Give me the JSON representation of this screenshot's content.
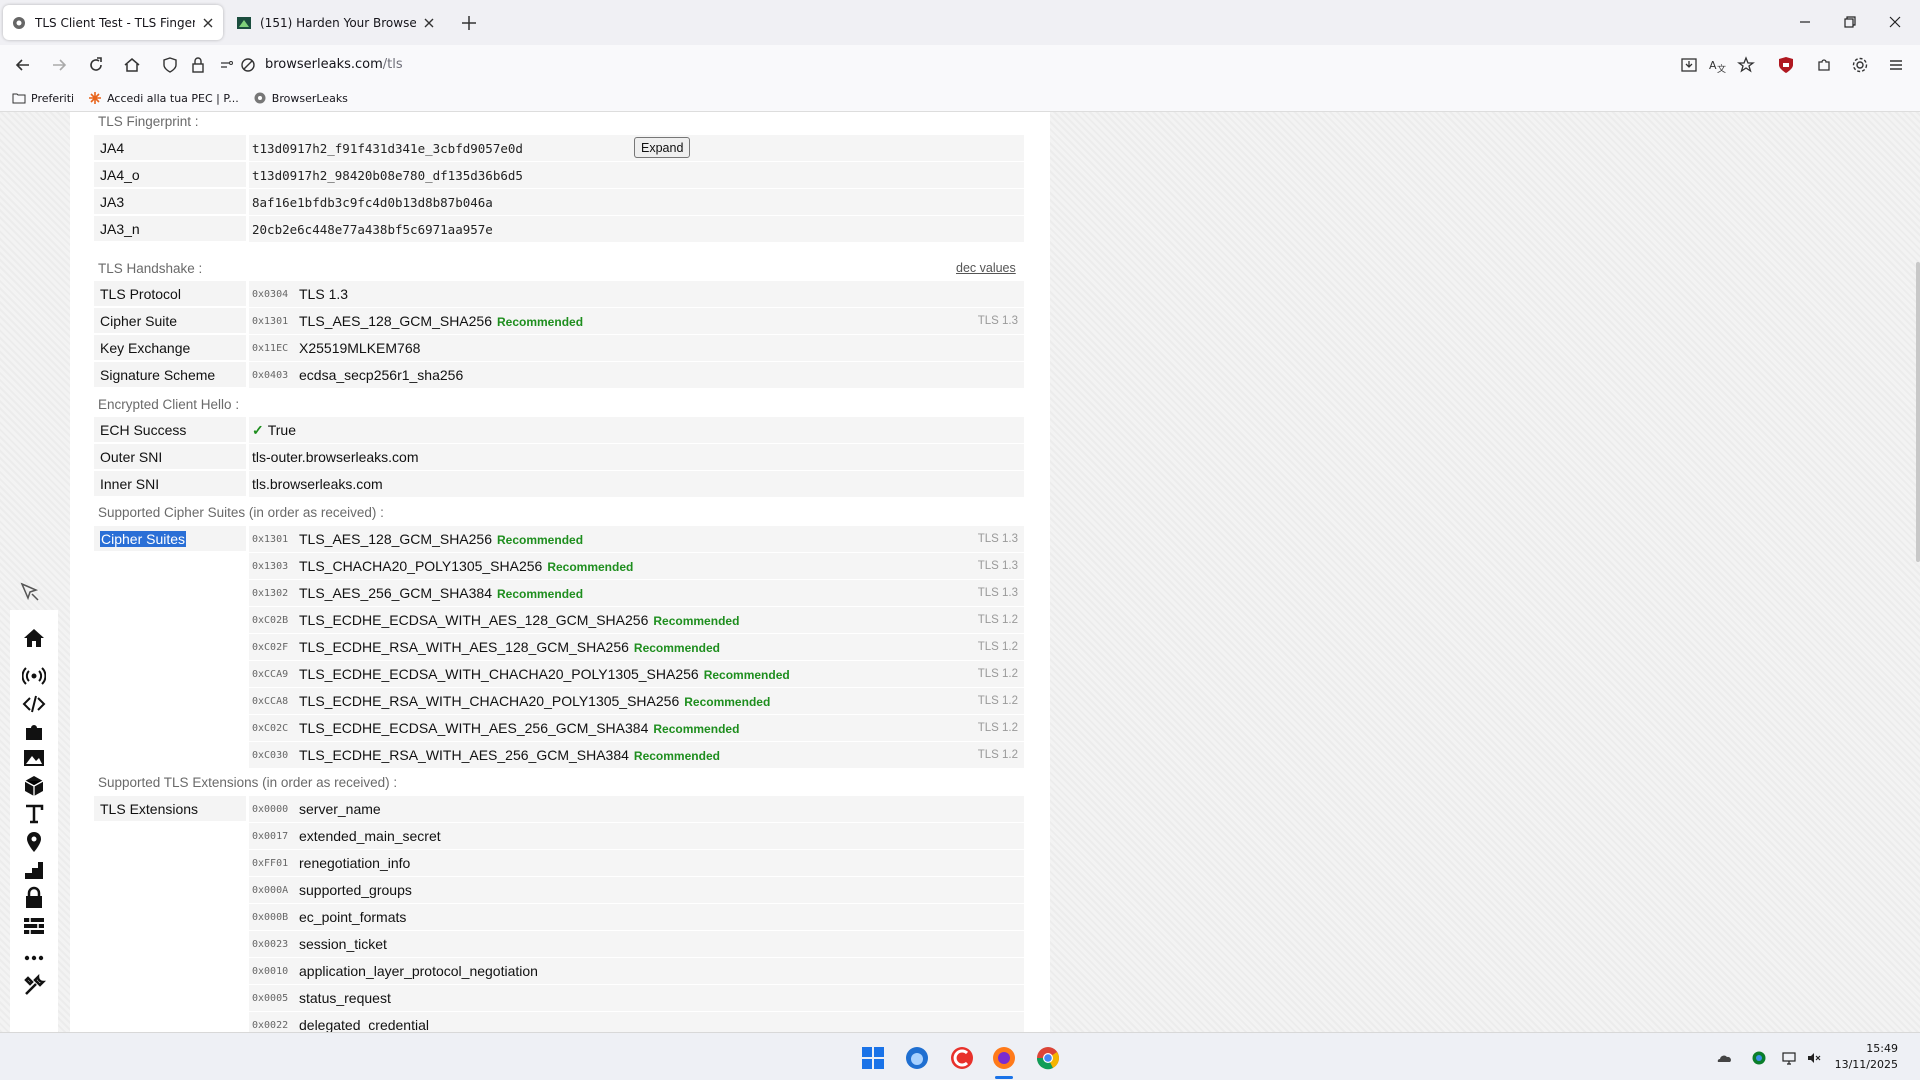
{
  "browser": {
    "tabs": [
      {
        "title": "TLS Client Test - TLS Fingerprint",
        "active": true
      },
      {
        "title": "(151) Harden Your Browser Like",
        "active": false
      }
    ],
    "url_host": "browserleaks.com",
    "url_path": "/tls",
    "bookmarks": [
      {
        "label": "Preferiti",
        "icon": "folder-icon"
      },
      {
        "label": "Accedi alla tua PEC | P...",
        "icon": "pec-icon"
      },
      {
        "label": "BrowserLeaks",
        "icon": "browserleaks-icon"
      }
    ]
  },
  "fingerprint": {
    "heading": "TLS Fingerprint :",
    "expand_label": "Expand",
    "rows": [
      {
        "label": "JA4",
        "value": "t13d0917h2_f91f431d341e_3cbfd9057e0d"
      },
      {
        "label": "JA4_o",
        "value": "t13d0917h2_98420b08e780_df135d36b6d5"
      },
      {
        "label": "JA3",
        "value": "8af16e1bfdb3c9fc4d0b13d8b87b046a"
      },
      {
        "label": "JA3_n",
        "value": "20cb2e6c448e77a438bf5c6971aa957e"
      }
    ]
  },
  "handshake": {
    "heading": "TLS Handshake :",
    "dec_link": "dec values",
    "rows": [
      {
        "label": "TLS Protocol",
        "hex": "0x0304",
        "value": "TLS 1.3",
        "rec": "",
        "ver": ""
      },
      {
        "label": "Cipher Suite",
        "hex": "0x1301",
        "value": "TLS_AES_128_GCM_SHA256",
        "rec": "Recommended",
        "ver": "TLS 1.3"
      },
      {
        "label": "Key Exchange",
        "hex": "0x11EC",
        "value": "X25519MLKEM768",
        "rec": "",
        "ver": ""
      },
      {
        "label": "Signature Scheme",
        "hex": "0x0403",
        "value": "ecdsa_secp256r1_sha256",
        "rec": "",
        "ver": ""
      }
    ]
  },
  "ech": {
    "heading": "Encrypted Client Hello :",
    "success_label": "ECH Success",
    "success_value": "True",
    "outer_label": "Outer SNI",
    "outer_value": "tls-outer.browserleaks.com",
    "inner_label": "Inner SNI",
    "inner_value": "tls.browserleaks.com"
  },
  "ciphers": {
    "heading": "Supported Cipher Suites (in order as received) :",
    "label": "Cipher Suites",
    "rows": [
      {
        "hex": "0x1301",
        "value": "TLS_AES_128_GCM_SHA256",
        "rec": "Recommended",
        "ver": "TLS 1.3"
      },
      {
        "hex": "0x1303",
        "value": "TLS_CHACHA20_POLY1305_SHA256",
        "rec": "Recommended",
        "ver": "TLS 1.3"
      },
      {
        "hex": "0x1302",
        "value": "TLS_AES_256_GCM_SHA384",
        "rec": "Recommended",
        "ver": "TLS 1.3"
      },
      {
        "hex": "0xC02B",
        "value": "TLS_ECDHE_ECDSA_WITH_AES_128_GCM_SHA256",
        "rec": "Recommended",
        "ver": "TLS 1.2"
      },
      {
        "hex": "0xC02F",
        "value": "TLS_ECDHE_RSA_WITH_AES_128_GCM_SHA256",
        "rec": "Recommended",
        "ver": "TLS 1.2"
      },
      {
        "hex": "0xCCA9",
        "value": "TLS_ECDHE_ECDSA_WITH_CHACHA20_POLY1305_SHA256",
        "rec": "Recommended",
        "ver": "TLS 1.2"
      },
      {
        "hex": "0xCCA8",
        "value": "TLS_ECDHE_RSA_WITH_CHACHA20_POLY1305_SHA256",
        "rec": "Recommended",
        "ver": "TLS 1.2"
      },
      {
        "hex": "0xC02C",
        "value": "TLS_ECDHE_ECDSA_WITH_AES_256_GCM_SHA384",
        "rec": "Recommended",
        "ver": "TLS 1.2"
      },
      {
        "hex": "0xC030",
        "value": "TLS_ECDHE_RSA_WITH_AES_256_GCM_SHA384",
        "rec": "Recommended",
        "ver": "TLS 1.2"
      }
    ]
  },
  "extensions": {
    "heading": "Supported TLS Extensions (in order as received) :",
    "label": "TLS Extensions",
    "rows": [
      {
        "hex": "0x0000",
        "value": "server_name"
      },
      {
        "hex": "0x0017",
        "value": "extended_main_secret"
      },
      {
        "hex": "0xFF01",
        "value": "renegotiation_info"
      },
      {
        "hex": "0x000A",
        "value": "supported_groups"
      },
      {
        "hex": "0x000B",
        "value": "ec_point_formats"
      },
      {
        "hex": "0x0023",
        "value": "session_ticket"
      },
      {
        "hex": "0x0010",
        "value": "application_layer_protocol_negotiation"
      },
      {
        "hex": "0x0005",
        "value": "status_request"
      },
      {
        "hex": "0x0022",
        "value": "delegated_credential"
      }
    ]
  },
  "taskbar": {
    "time": "15:49",
    "date": "13/11/2025"
  },
  "colors": {
    "recommended": "#1e8e1e",
    "selection": "#2a6fd6"
  }
}
